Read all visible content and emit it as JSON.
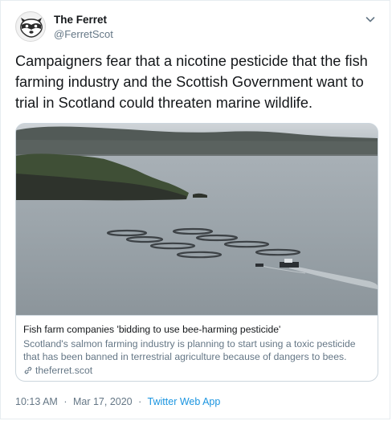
{
  "user": {
    "display_name": "The Ferret",
    "handle": "@FerretScot"
  },
  "icons": {
    "avatar": "ferret-logo-icon",
    "menu": "chevron-down-icon",
    "link": "link-icon"
  },
  "tweet": {
    "text": "Campaigners fear that a nicotine pesticide that the fish farming industry and the Scottish Government want to trial in Scotland could threaten marine wildlife."
  },
  "card": {
    "image_alt": "fish-farm-aerial-photo",
    "title": "Fish farm companies 'bidding to use bee-harming pesticide'",
    "description": "Scotland's salmon farming industry is planning to start using a toxic pesticide that has been banned in terrestrial agriculture because of dangers to bees.",
    "domain": "theferret.scot"
  },
  "footer": {
    "time": "10:13 AM",
    "separator": "·",
    "date": "Mar 17, 2020",
    "separator2": "·",
    "source": "Twitter Web App"
  },
  "colors": {
    "link": "#1b95e0",
    "secondary_text": "#657786",
    "border": "#ccd6dd"
  }
}
